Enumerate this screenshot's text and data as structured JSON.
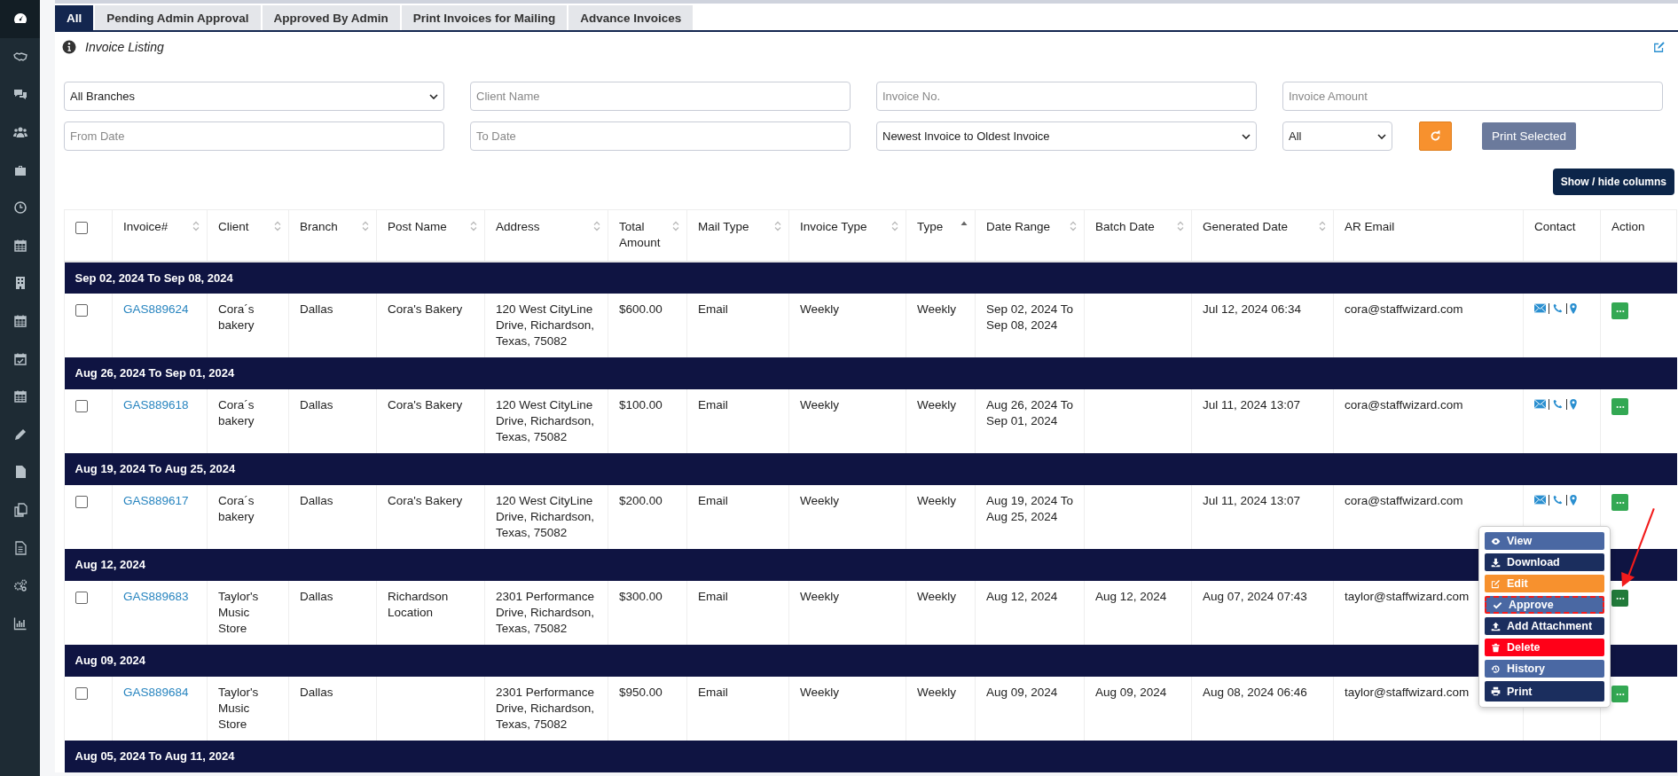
{
  "sidebar": {
    "items": [
      {
        "selected": true
      },
      {
        "selected": false
      },
      {
        "selected": false
      },
      {
        "selected": false
      },
      {
        "selected": false
      },
      {
        "selected": false
      },
      {
        "selected": false
      },
      {
        "selected": false
      },
      {
        "selected": false
      },
      {
        "selected": false
      },
      {
        "selected": false
      },
      {
        "selected": false
      },
      {
        "selected": false
      },
      {
        "selected": false
      },
      {
        "selected": false
      },
      {
        "selected": false
      },
      {
        "selected": false
      }
    ]
  },
  "tabs": [
    {
      "label": "All",
      "selected": true
    },
    {
      "label": "Pending Admin Approval",
      "selected": false
    },
    {
      "label": "Approved By Admin",
      "selected": false
    },
    {
      "label": "Print Invoices for Mailing",
      "selected": false
    },
    {
      "label": "Advance Invoices",
      "selected": false
    }
  ],
  "section_title": "Invoice Listing",
  "filters": {
    "branch": "All Branches",
    "client_name": {
      "placeholder": "Client Name"
    },
    "invoice_no": {
      "placeholder": "Invoice No."
    },
    "invoice_amount": {
      "placeholder": "Invoice Amount"
    },
    "from_date": {
      "placeholder": "From Date"
    },
    "to_date": {
      "placeholder": "To Date"
    },
    "sort_order": "Newest Invoice to Oldest Invoice",
    "status": "All",
    "print_button": "Print Selected"
  },
  "columns_button": "Show / hide columns",
  "table": {
    "select_all": {
      "checked": false
    },
    "columns": [
      {
        "label": "Invoice#",
        "sortable": true,
        "sorted_ascending": false
      },
      {
        "label": "Client",
        "sortable": true,
        "sorted_ascending": false
      },
      {
        "label": "Branch",
        "sortable": true,
        "sorted_ascending": false
      },
      {
        "label": "Post Name",
        "sortable": true,
        "sorted_ascending": false
      },
      {
        "label": "Address",
        "sortable": true,
        "sorted_ascending": false
      },
      {
        "label": "Total Amount",
        "sortable": true,
        "sorted_ascending": false
      },
      {
        "label": "Mail Type",
        "sortable": true,
        "sorted_ascending": false
      },
      {
        "label": "Invoice Type",
        "sortable": true,
        "sorted_ascending": false
      },
      {
        "label": "Type",
        "sortable": true,
        "sorted_ascending": true
      },
      {
        "label": "Date Range",
        "sortable": true,
        "sorted_ascending": false
      },
      {
        "label": "Batch Date",
        "sortable": true,
        "sorted_ascending": false
      },
      {
        "label": "Generated Date",
        "sortable": true,
        "sorted_ascending": false
      },
      {
        "label": "AR Email",
        "sortable": false
      },
      {
        "label": "Contact",
        "sortable": false
      },
      {
        "label": "Action",
        "sortable": false
      }
    ],
    "groups": [
      {
        "label": "Sep 02, 2024 To Sep 08, 2024",
        "rows": [
          {
            "checked": false,
            "menu_open": false,
            "cells": [
              "GAS889624",
              "Cora´s bakery",
              "Dallas",
              "Cora's Bakery",
              "120 West CityLine Drive, Richardson, Texas, 75082",
              "$600.00",
              "Email",
              "Weekly",
              "Weekly",
              "Sep 02, 2024 To Sep 08, 2024",
              "",
              "Jul 12, 2024 06:34",
              "cora@staffwizard.com"
            ]
          }
        ]
      },
      {
        "label": "Aug 26, 2024 To Sep 01, 2024",
        "rows": [
          {
            "checked": false,
            "menu_open": false,
            "cells": [
              "GAS889618",
              "Cora´s bakery",
              "Dallas",
              "Cora's Bakery",
              "120 West CityLine Drive, Richardson, Texas, 75082",
              "$100.00",
              "Email",
              "Weekly",
              "Weekly",
              "Aug 26, 2024 To Sep 01, 2024",
              "",
              "Jul 11, 2024 13:07",
              "cora@staffwizard.com"
            ]
          }
        ]
      },
      {
        "label": "Aug 19, 2024 To Aug 25, 2024",
        "rows": [
          {
            "checked": false,
            "menu_open": false,
            "cells": [
              "GAS889617",
              "Cora´s bakery",
              "Dallas",
              "Cora's Bakery",
              "120 West CityLine Drive, Richardson, Texas, 75082",
              "$200.00",
              "Email",
              "Weekly",
              "Weekly",
              "Aug 19, 2024 To Aug 25, 2024",
              "",
              "Jul 11, 2024 13:07",
              "cora@staffwizard.com"
            ]
          }
        ]
      },
      {
        "label": "Aug 12, 2024",
        "rows": [
          {
            "checked": false,
            "menu_open": true,
            "cells": [
              "GAS889683",
              "Taylor's Music Store",
              "Dallas",
              "Richardson Location",
              "2301 Performance Drive, Richardson, Texas, 75082",
              "$300.00",
              "Email",
              "Weekly",
              "Weekly",
              "Aug 12, 2024",
              "Aug 12, 2024",
              "Aug 07, 2024 07:43",
              "taylor@staffwizard.com"
            ]
          }
        ]
      },
      {
        "label": "Aug 09, 2024",
        "rows": [
          {
            "checked": false,
            "menu_open": false,
            "cells": [
              "GAS889684",
              "Taylor's Music Store",
              "Dallas",
              "",
              "2301 Performance Drive, Richardson, Texas, 75082",
              "$950.00",
              "Email",
              "Weekly",
              "Weekly",
              "Aug 09, 2024",
              "Aug 09, 2024",
              "Aug 08, 2024 06:46",
              "taylor@staffwizard.com"
            ]
          }
        ]
      },
      {
        "label": "Aug 05, 2024 To Aug 11, 2024"
      }
    ]
  },
  "action_menu": [
    {
      "label": "View",
      "color": "#4a68a3",
      "highlighted": false
    },
    {
      "label": "Download",
      "color": "#1b2e5e",
      "highlighted": false
    },
    {
      "label": "Edit",
      "color": "#f7912e",
      "highlighted": false
    },
    {
      "label": "Approve",
      "color": "#4a68a3",
      "highlighted": true
    },
    {
      "label": "Add Attachment",
      "color": "#1b2e5e",
      "highlighted": false
    },
    {
      "label": "Delete",
      "color": "#ff0018",
      "highlighted": false
    },
    {
      "label": "History",
      "color": "#4a68a3",
      "highlighted": false
    },
    {
      "label": "Print",
      "color": "#1b2e5e",
      "highlighted": false
    }
  ]
}
